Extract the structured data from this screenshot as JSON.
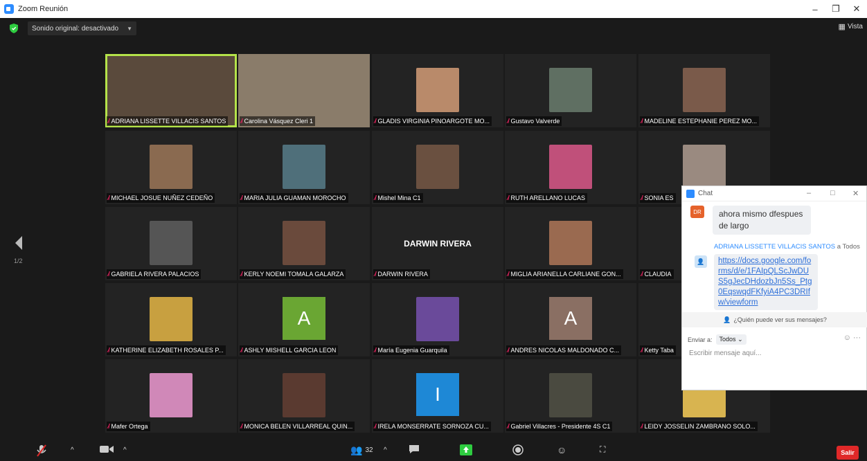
{
  "window": {
    "title": "Zoom Reunión"
  },
  "topbar": {
    "sound_label": "Sonido original: desactivado",
    "view_label": "Vista"
  },
  "pager": {
    "page": "1/2"
  },
  "participants": [
    {
      "name": "ADRIANA LISSETTE VILLACIS SANTOS",
      "kind": "video",
      "color": "#5a4a3c"
    },
    {
      "name": "Carolina Vásquez Cleri 1",
      "kind": "video",
      "color": "#8a7c6a"
    },
    {
      "name": "GLADIS VIRGINIA PINOARGOTE MO...",
      "kind": "photo",
      "color": "#b98a6a"
    },
    {
      "name": "Gustavo Valverde",
      "kind": "photo",
      "color": "#5f6f62"
    },
    {
      "name": "MADELINE ESTEPHANIE PEREZ MO...",
      "kind": "photo",
      "color": "#7a5a4a"
    },
    {
      "name": "MICHAEL JOSUE NUÑEZ CEDEÑO",
      "kind": "photo",
      "color": "#8a6a50"
    },
    {
      "name": "MARIA JULIA GUAMAN MOROCHO",
      "kind": "photo",
      "color": "#4f6f7a"
    },
    {
      "name": "Mishel Mina C1",
      "kind": "photo",
      "color": "#6a5040"
    },
    {
      "name": "RUTH ARELLANO LUCAS",
      "kind": "photo",
      "color": "#c0507a"
    },
    {
      "name": "SONIA ES",
      "kind": "photo",
      "color": "#9a8a80"
    },
    {
      "name": "GABRIELA RIVERA PALACIOS",
      "kind": "photo",
      "color": "#555555"
    },
    {
      "name": "KERLY NOEMI TOMALA GALARZA",
      "kind": "photo",
      "color": "#6a4a3c"
    },
    {
      "name": "DARWIN RIVERA",
      "kind": "text",
      "big": "DARWIN RIVERA"
    },
    {
      "name": "MIGLIA ARIANELLA CARLIANE GON...",
      "kind": "photo",
      "color": "#9a6a50"
    },
    {
      "name": "CLAUDIA",
      "kind": "photo",
      "color": "#6a6a6a"
    },
    {
      "name": "KATHERINE ELIZABETH ROSALES P...",
      "kind": "photo",
      "color": "#c8a040"
    },
    {
      "name": "ASHLY MISHELL GARCIA LEON",
      "kind": "avatar",
      "letter": "A",
      "color": "#6aa633"
    },
    {
      "name": "María Eugenia Guarquila",
      "kind": "photo",
      "color": "#6a4a9a"
    },
    {
      "name": "ANDRES NICOLAS MALDONADO C...",
      "kind": "avatar",
      "letter": "A",
      "color": "#8a6f63"
    },
    {
      "name": "Ketty Taba",
      "kind": "photo",
      "color": "#5a5a5a"
    },
    {
      "name": "Mafer Ortega",
      "kind": "photo",
      "color": "#d088b8"
    },
    {
      "name": "MONICA BELEN VILLARREAL QUIN...",
      "kind": "photo",
      "color": "#5a3a30"
    },
    {
      "name": "IRELA MONSERRATE SORNOZA CU...",
      "kind": "avatar",
      "letter": "I",
      "color": "#1e88d6"
    },
    {
      "name": "Gabriel Villacres - Presidente 4S C1",
      "kind": "photo",
      "color": "#4a4a40"
    },
    {
      "name": "LEIDY JOSSELIN ZAMBRANO SOLO...",
      "kind": "photo",
      "color": "#d8b450"
    }
  ],
  "toolbar": {
    "participants_count": "32",
    "exit_label": "Salir"
  },
  "chat": {
    "title": "Chat",
    "msg1_avatar": "DR",
    "msg1_text": "ahora mismo dfespues de largo",
    "sender_name": "ADRIANA LISSETTE VILLACIS SANTOS",
    "sender_to": "a Todos",
    "link_text": "https://docs.google.com/forms/d/e/1FAIpQLScJwDUS5gJecDHdozbJn5Ss_Ptg0EqswqdFKfyiA4PC3DRIfw/viewform",
    "who_label": "¿Quién puede ver sus mensajes?",
    "send_to_label": "Enviar a:",
    "send_to_value": "Todos",
    "input_placeholder": "Escribir mensaje aquí..."
  },
  "colors": {
    "accent": "#2d8cff",
    "active_speaker": "#b5e34a",
    "exit": "#e02828"
  }
}
